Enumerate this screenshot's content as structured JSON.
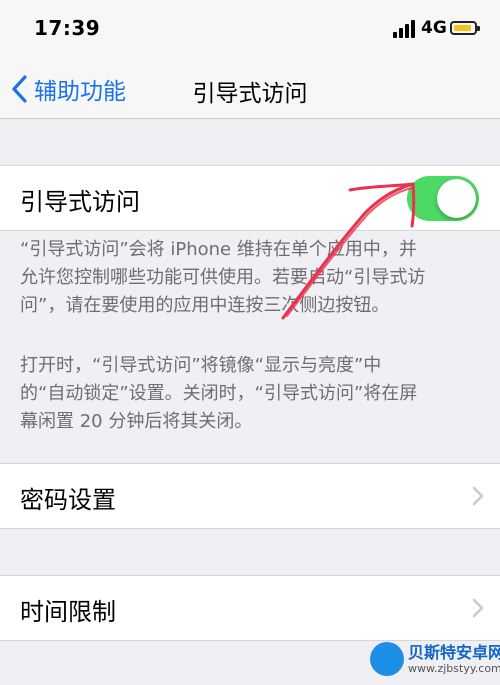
{
  "status_bar": {
    "time": "17:39",
    "network": "4G",
    "battery_color": "#f5c519"
  },
  "nav": {
    "back_label": "辅助功能",
    "title": "引导式访问"
  },
  "guided_access": {
    "label": "引导式访问",
    "toggle_on": true,
    "toggle_color": "#4cd964"
  },
  "footer": {
    "line1": "“引导式访问”会将 iPhone 维持在单个应用中，并",
    "line2": "允许您控制哪些功能可供使用。若要启动“引导式访",
    "line3": "问”，请在要使用的应用中连按三次侧边按钮。",
    "line4": "打开时，“引导式访问”将镜像“显示与亮度”中",
    "line5": "的“自动锁定”设置。关闭时，“引导式访问”将在屏",
    "line6": "幕闲置 20 分钟后将其关闭。"
  },
  "passcode_settings": {
    "label": "密码设置"
  },
  "time_limits": {
    "label": "时间限制"
  },
  "watermark": {
    "title": "贝斯特安卓网",
    "url": "www.zjbstyy.com"
  },
  "colors": {
    "accent": "#1a73e8",
    "annotation_arrow": "#e8334f"
  }
}
